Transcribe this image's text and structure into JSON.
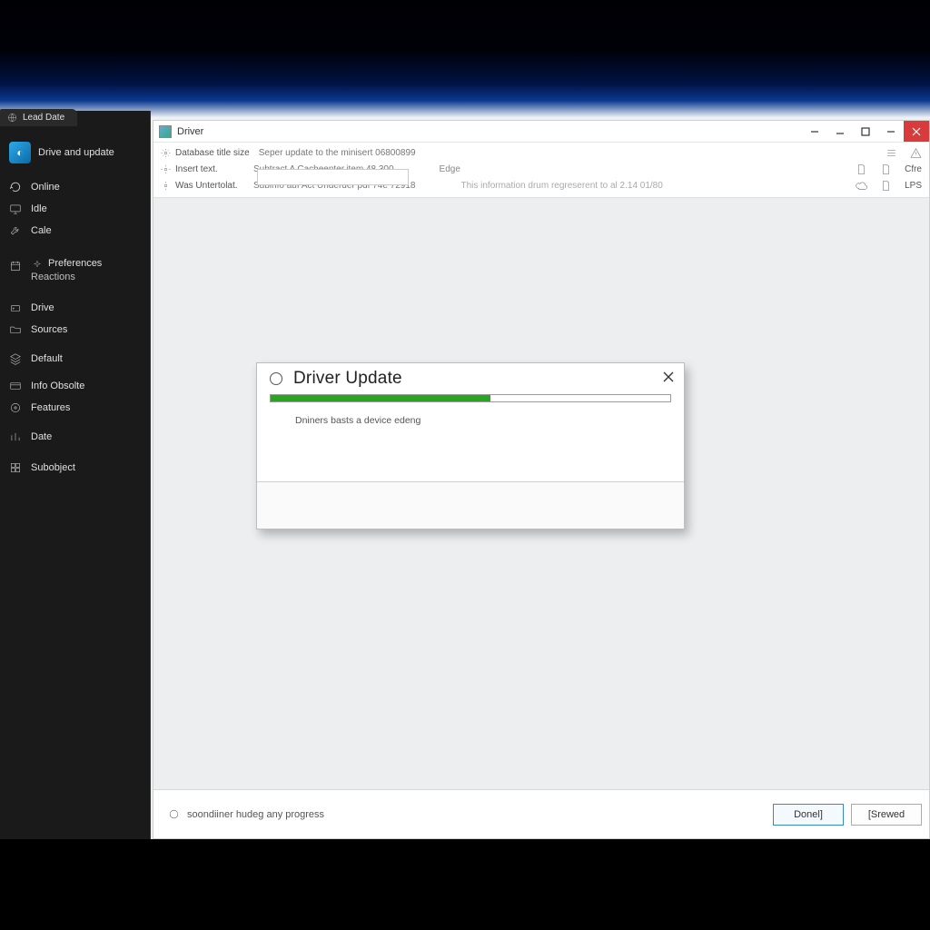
{
  "sidebar": {
    "tab": "Lead Date",
    "header": "Drive and update",
    "items": [
      {
        "label": "Online"
      },
      {
        "label": "Idle"
      },
      {
        "label": "Cale"
      }
    ],
    "subitems": [
      {
        "label": "Preferences"
      },
      {
        "label": "Reactions"
      }
    ],
    "group2": [
      {
        "label": "Drive"
      },
      {
        "label": "Sources"
      },
      {
        "label": "Default"
      },
      {
        "label": "Info Obsolte"
      },
      {
        "label": "Features"
      },
      {
        "label": "Date"
      },
      {
        "label": "Subobject"
      }
    ]
  },
  "titlebar": {
    "app_name": "Driver"
  },
  "toolbar": {
    "rows": [
      {
        "label": "Database title size",
        "value": "Seper update to the minisert 06800899",
        "edgecol": ""
      },
      {
        "label": "Insert text.",
        "value": "Subtract    A Cacheenter.item 48 300",
        "edgecol": "Edge"
      },
      {
        "label": "Was Untertolat.",
        "value": "Subinfo auf Act Underder pdf 74e 72918",
        "edgecol": "This information drum regreserent to al 2.14 01/80"
      }
    ],
    "right_text": "Cfre",
    "right_text2": "LPS"
  },
  "dialog": {
    "title": "Driver Update",
    "status_text": "Dniners basts a device edeng",
    "progress_pct": 55
  },
  "statusbar": {
    "text": "soondiiner hudeg any progress",
    "primary_btn": "Donel]",
    "secondary_btn": "[Srewed"
  }
}
